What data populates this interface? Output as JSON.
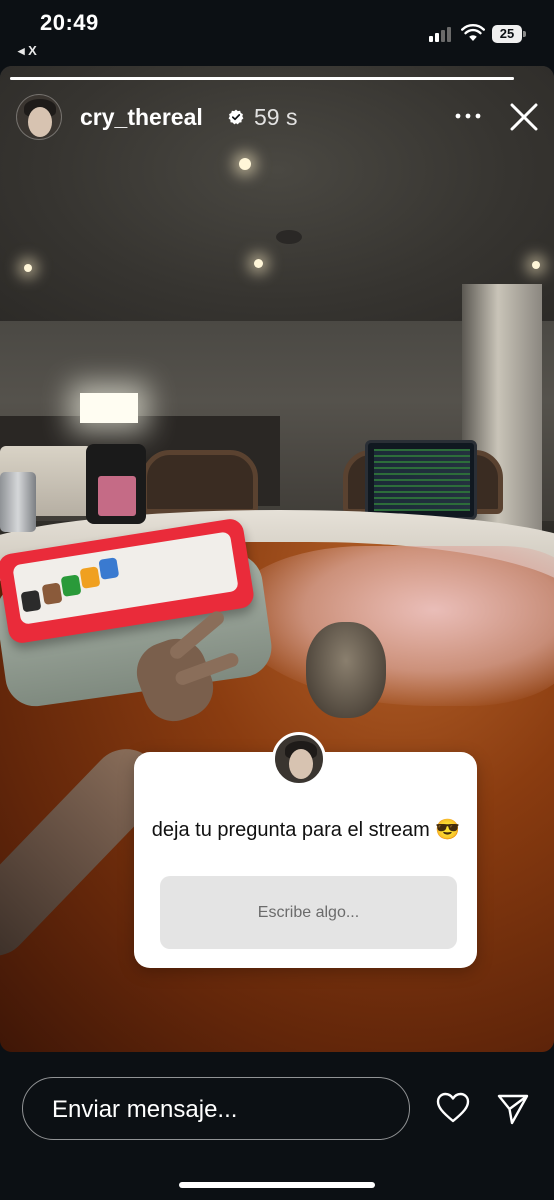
{
  "status_bar": {
    "time": "20:49",
    "back_app": "◂ X",
    "battery": "25",
    "icons": [
      "signal-icon",
      "wifi-icon",
      "battery-icon"
    ]
  },
  "story": {
    "progress_fraction": 1.0,
    "username": "cry_thereal",
    "verified": true,
    "elapsed": "59 s",
    "more_icon": "more-horizontal-icon",
    "close_icon": "close-icon"
  },
  "question_sticker": {
    "question": "deja tu pregunta para el stream 😎",
    "answer_placeholder": "Escribe algo..."
  },
  "reply_bar": {
    "message_placeholder": "Enviar mensaje...",
    "like_icon": "heart-icon",
    "send_icon": "send-icon"
  },
  "colors": {
    "background": "#0c1014",
    "verified_badge": "#ffffff",
    "sticker_bg": "#ffffff",
    "answer_box_bg": "#e4e4e4"
  }
}
